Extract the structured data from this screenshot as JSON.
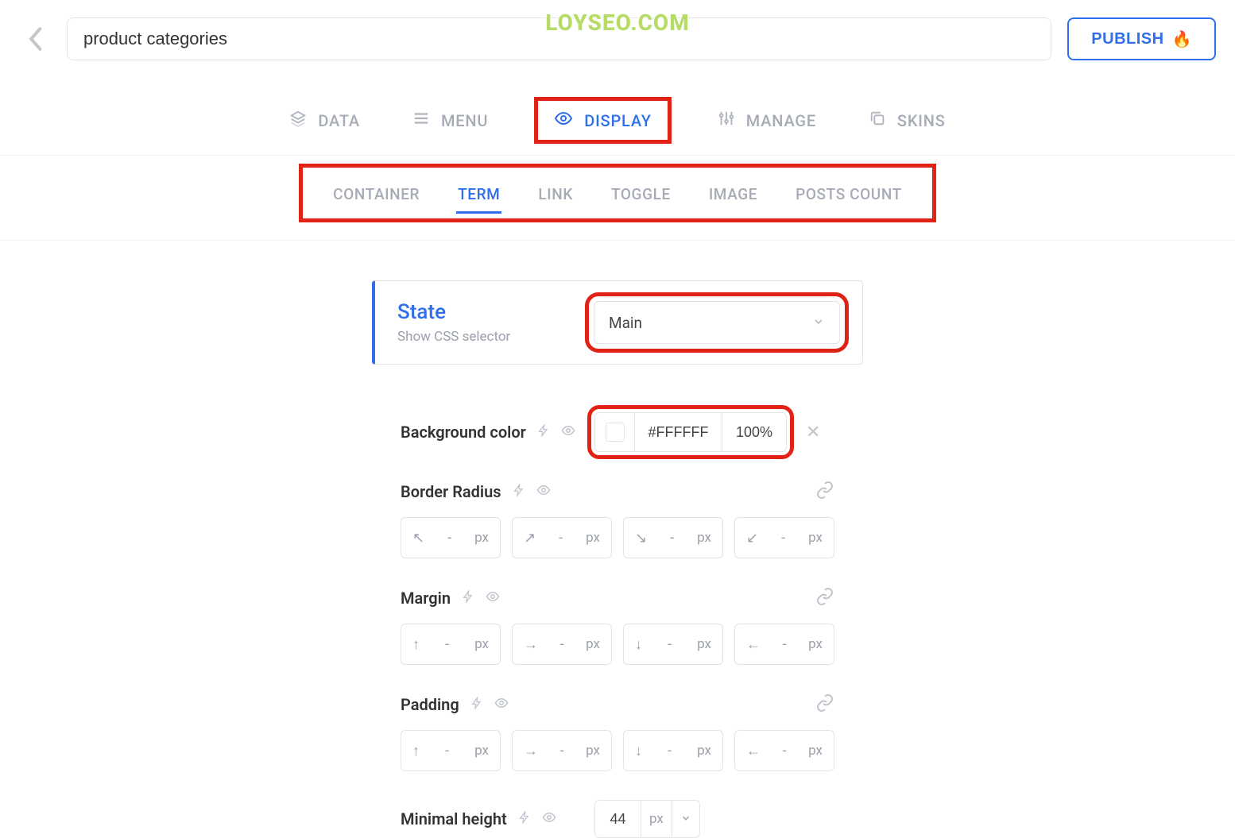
{
  "watermark": "LOYSEO.COM",
  "header": {
    "title_value": "product categories",
    "publish_label": "PUBLISH",
    "publish_emoji": "🔥"
  },
  "main_tabs": [
    {
      "label": "DATA"
    },
    {
      "label": "MENU"
    },
    {
      "label": "DISPLAY"
    },
    {
      "label": "MANAGE"
    },
    {
      "label": "SKINS"
    }
  ],
  "sub_tabs": [
    {
      "label": "CONTAINER"
    },
    {
      "label": "TERM"
    },
    {
      "label": "LINK"
    },
    {
      "label": "TOGGLE"
    },
    {
      "label": "IMAGE"
    },
    {
      "label": "POSTS COUNT"
    }
  ],
  "state_card": {
    "title": "State",
    "subtitle": "Show CSS selector",
    "selected": "Main"
  },
  "bg": {
    "label": "Background color",
    "hex": "#FFFFFF",
    "alpha": "100%"
  },
  "border_radius": {
    "label": "Border Radius",
    "value": "-",
    "unit": "px",
    "arrows": [
      "↖",
      "↗",
      "↘",
      "↙"
    ]
  },
  "margin": {
    "label": "Margin",
    "value": "-",
    "unit": "px",
    "arrows": [
      "↑",
      "→",
      "↓",
      "←"
    ]
  },
  "padding": {
    "label": "Padding",
    "value": "-",
    "unit": "px",
    "arrows": [
      "↑",
      "→",
      "↓",
      "←"
    ]
  },
  "min_height": {
    "label": "Minimal height",
    "value": "44",
    "unit": "px"
  }
}
